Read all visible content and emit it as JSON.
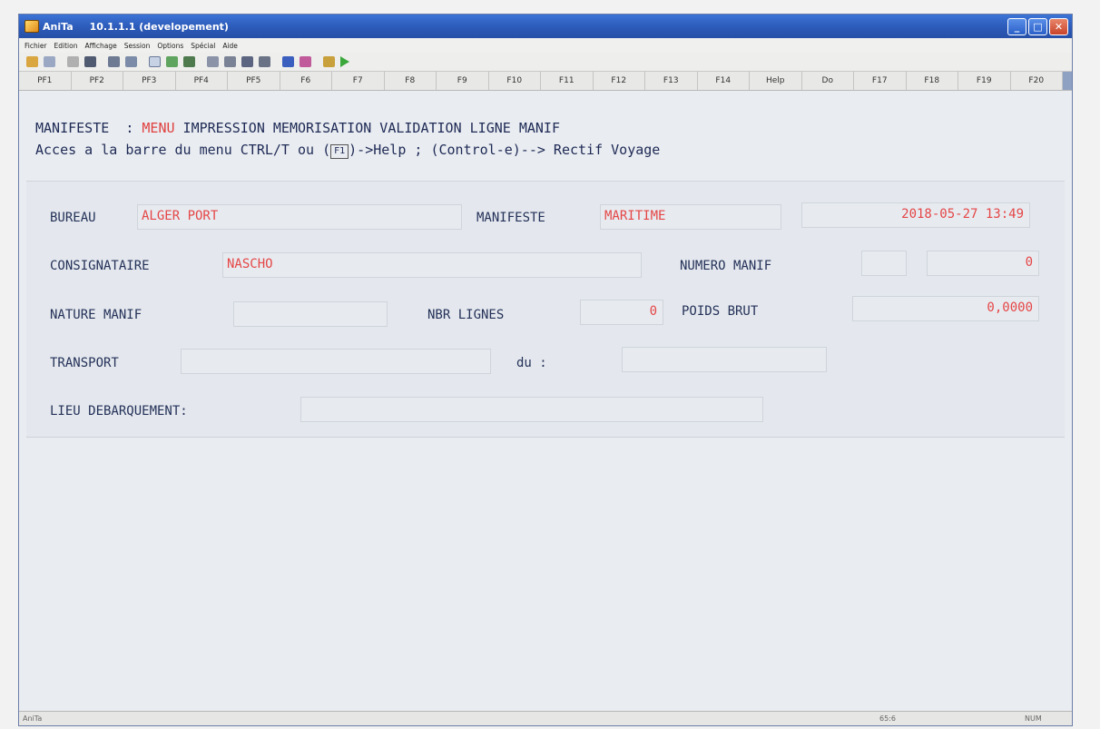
{
  "window": {
    "app_name": "AniTa",
    "version": "10.1.1.1 (developement)",
    "controls": {
      "minimize": "_",
      "maximize": "□",
      "close": "✕"
    }
  },
  "menu": [
    "Fichier",
    "Edition",
    "Affichage",
    "Session",
    "Options",
    "Spécial",
    "Aide"
  ],
  "toolbar_icons": [
    "open-icon",
    "save-icon",
    "cut-icon",
    "copy-icon",
    "print-icon",
    "print-preview-icon",
    "window-icon",
    "run-icon",
    "refresh-icon",
    "list-icon",
    "table-icon",
    "sort-icon",
    "chart-icon",
    "pointer-icon",
    "select-icon",
    "tools-icon",
    "play-icon"
  ],
  "function_keys": [
    "PF1",
    "PF2",
    "PF3",
    "PF4",
    "PF5",
    "F6",
    "F7",
    "F8",
    "F9",
    "F10",
    "F11",
    "F12",
    "F13",
    "F14",
    "Help",
    "Do",
    "F17",
    "F18",
    "F19",
    "F20"
  ],
  "header": {
    "line1_prefix": "MANIFESTE  : ",
    "line1_menu": "MENU",
    "line1_rest": " IMPRESSION MEMORISATION VALIDATION LIGNE MANIF",
    "line2_prefix": "Acces a la barre du menu CTRL/T ou (",
    "line2_key": "F1",
    "line2_rest": ")->Help ; (Control-e)--> Rectif Voyage"
  },
  "form": {
    "bureau_label": "BUREAU",
    "bureau_value": "ALGER PORT",
    "manifeste_label": "MANIFESTE",
    "manifeste_value": "MARITIME",
    "datetime": "2018-05-27 13:49",
    "consignataire_label": "CONSIGNATAIRE",
    "consignataire_value": "NASCHO",
    "numero_label": "NUMERO MANIF",
    "numero_prefix_value": "",
    "numero_value": "0",
    "nature_label": "NATURE MANIF",
    "nature_value": "",
    "nbr_lignes_label": "NBR LIGNES",
    "nbr_lignes_value": "0",
    "poids_label": "POIDS BRUT",
    "poids_value": "0,0000",
    "transport_label": "TRANSPORT",
    "transport_value": "",
    "du_label": "du :",
    "du_value": "",
    "lieu_label": "LIEU DEBARQUEMENT:",
    "lieu_value": ""
  },
  "status": {
    "left": "AniTa",
    "position": "65:6",
    "mode": "NUM"
  }
}
